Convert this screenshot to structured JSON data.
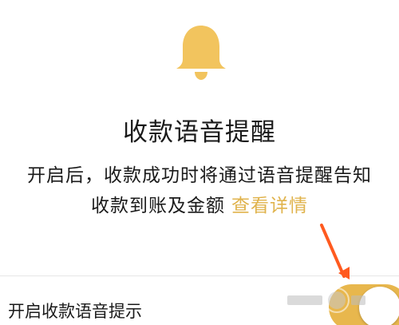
{
  "header": {
    "icon": "bell-icon",
    "icon_color": "#F2C45E",
    "title": "收款语音提醒"
  },
  "description": {
    "line1": "开启后，收款成功时将通过语音提醒告知",
    "line2": "收款到账及金额",
    "link_label": "查看详情",
    "link_color": "#E0B34C"
  },
  "setting": {
    "label": "开启收款语音提示",
    "toggle_on": true,
    "toggle_color": "#E8B74D"
  },
  "annotation": {
    "arrow_color": "#FF5A1F"
  }
}
